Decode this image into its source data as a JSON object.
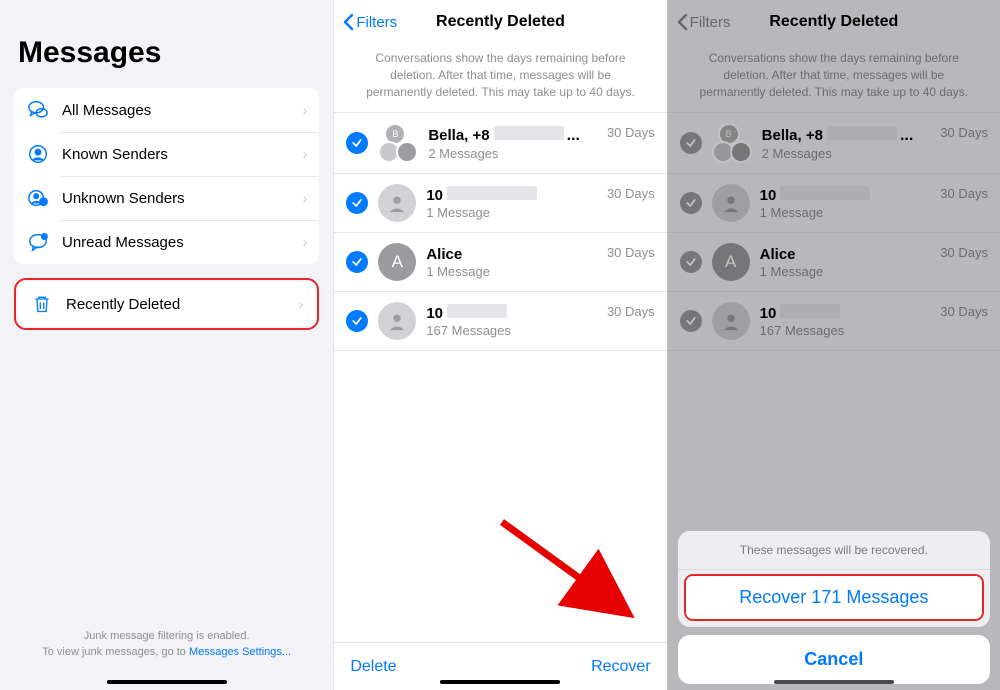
{
  "pane1": {
    "title": "Messages",
    "items": [
      {
        "label": "All Messages"
      },
      {
        "label": "Known Senders"
      },
      {
        "label": "Unknown Senders"
      },
      {
        "label": "Unread Messages"
      }
    ],
    "recently_deleted_label": "Recently Deleted",
    "footer_line1": "Junk message filtering is enabled.",
    "footer_line2_prefix": "To view junk messages, go to ",
    "footer_link": "Messages Settings..."
  },
  "pane2": {
    "back_label": "Filters",
    "title": "Recently Deleted",
    "subtext": "Conversations show the days remaining before deletion. After that time, messages will be permanently deleted. This may take up to 40 days.",
    "conversations": [
      {
        "name": "Bella, +8",
        "ellipsis": "...",
        "sub": "2 Messages",
        "days": "30 Days",
        "avatar": "group"
      },
      {
        "name": "10",
        "sub": "1 Message",
        "days": "30 Days",
        "avatar": "person"
      },
      {
        "name": "Alice",
        "letter": "A",
        "sub": "1 Message",
        "days": "30 Days",
        "avatar": "letter"
      },
      {
        "name": "10",
        "sub": "167 Messages",
        "days": "30 Days",
        "avatar": "person"
      }
    ],
    "delete_label": "Delete",
    "recover_label": "Recover"
  },
  "actionsheet": {
    "label": "These messages will be recovered.",
    "recover": "Recover 171 Messages",
    "cancel": "Cancel"
  }
}
